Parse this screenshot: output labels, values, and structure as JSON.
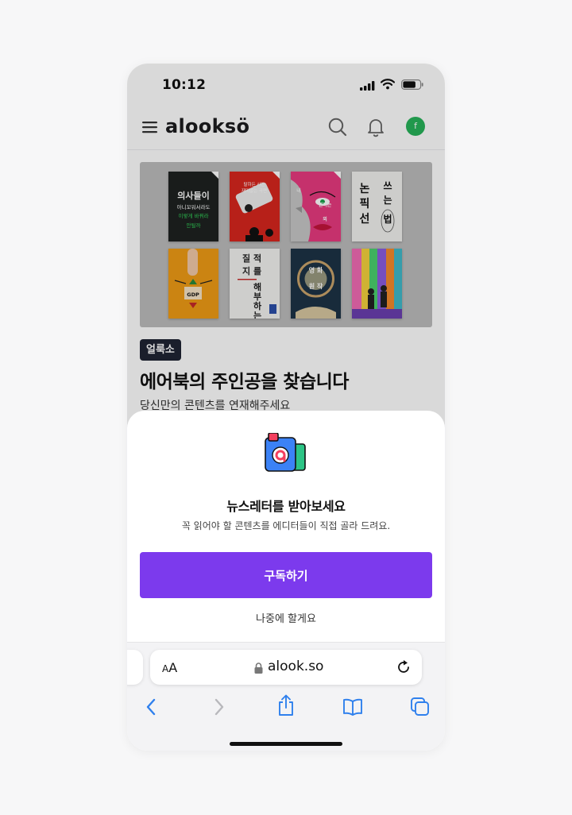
{
  "status_bar": {
    "time": "10:12"
  },
  "app": {
    "logo": "alooksö",
    "logo_text": "alooksö",
    "avatar_initial": "f"
  },
  "hero": {
    "posters": [
      {
        "lines": [
          "의사들이",
          "아니꼬워서라도",
          "이렇게 바꿔라",
          "안될까"
        ]
      },
      {
        "lines": [
          "탈하든 사는",
          "재미없는 곡면",
          "을 만들"
        ]
      },
      {
        "lines": [
          "내",
          "면이는",
          "외",
          "잉 수 에"
        ]
      },
      {
        "lines": [
          "논",
          "픽",
          "선",
          "쓰는",
          "법"
        ]
      },
      {
        "lines": [
          "GDP"
        ]
      },
      {
        "lines": [
          "질",
          "적",
          "지",
          "를",
          "해",
          "부",
          "하",
          "는"
        ]
      },
      {
        "lines": [
          "영",
          "화",
          "의",
          "원",
          "작"
        ]
      },
      {
        "lines": []
      }
    ]
  },
  "article": {
    "tag": "얼룩소",
    "title": "에어북의 주인공을 찾습니다",
    "subtitle": "당신만의 콘텐츠를 연재해주세요"
  },
  "sheet": {
    "title": "뉴스레터를 받아보세요",
    "description": "꼭 읽어야 할 콘텐츠를 에디터들이 직접 골라 드려요.",
    "subscribe_label": "구독하기",
    "later_label": "나중에 할게요"
  },
  "browser": {
    "aa_small": "A",
    "aa_big": "A",
    "url": "alook.so"
  },
  "colors": {
    "accent": "#7c3aed",
    "tag_bg": "#1f2433",
    "avatar": "#27b35a"
  },
  "icons": [
    "menu-icon",
    "search-icon",
    "bell-icon",
    "lock-icon",
    "reload-icon",
    "back-icon",
    "forward-icon",
    "share-icon",
    "bookmarks-icon",
    "tabs-icon"
  ]
}
